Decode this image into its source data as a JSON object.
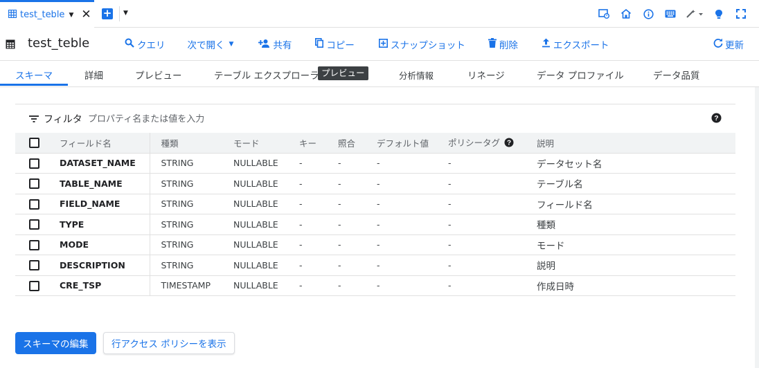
{
  "colors": {
    "accent": "#1a73e8",
    "text": "#202124",
    "muted": "#5f6368",
    "divider": "#e0e0e0"
  },
  "tab": {
    "name": "test_teble",
    "icon": "table-icon"
  },
  "header": {
    "title": "test_teble",
    "actions": [
      {
        "id": "query",
        "label": "クエリ",
        "icon": "search-icon"
      },
      {
        "id": "open-with",
        "label": "次で開く",
        "icon": "chevron-down-icon"
      },
      {
        "id": "share",
        "label": "共有",
        "icon": "person-add-icon"
      },
      {
        "id": "copy",
        "label": "コピー",
        "icon": "copy-icon"
      },
      {
        "id": "snapshot",
        "label": "スナップショット",
        "icon": "snapshot-icon"
      },
      {
        "id": "delete",
        "label": "削除",
        "icon": "trash-icon"
      },
      {
        "id": "export",
        "label": "エクスポート",
        "icon": "upload-icon"
      }
    ],
    "refresh_label": "更新"
  },
  "subtabs": [
    {
      "label": "スキーマ",
      "active": true
    },
    {
      "label": "詳細"
    },
    {
      "label": "プレビュー"
    },
    {
      "label": "テーブル エクスプローラ"
    },
    {
      "label": "分析情報"
    },
    {
      "label": "リネージ"
    },
    {
      "label": "データ プロファイル"
    },
    {
      "label": "データ品質"
    }
  ],
  "preview_badge": "プレビュー",
  "filter": {
    "label": "フィルタ",
    "placeholder": "プロパティ名または値を入力"
  },
  "table": {
    "headers": [
      "フィールド名",
      "種類",
      "モード",
      "キー",
      "照合",
      "デフォルト値",
      "ポリシータグ",
      "説明"
    ],
    "rows": [
      {
        "name": "DATASET_NAME",
        "type": "STRING",
        "mode": "NULLABLE",
        "key": "-",
        "collation": "-",
        "default": "-",
        "policy": "-",
        "description": "データセット名"
      },
      {
        "name": "TABLE_NAME",
        "type": "STRING",
        "mode": "NULLABLE",
        "key": "-",
        "collation": "-",
        "default": "-",
        "policy": "-",
        "description": "テーブル名"
      },
      {
        "name": "FIELD_NAME",
        "type": "STRING",
        "mode": "NULLABLE",
        "key": "-",
        "collation": "-",
        "default": "-",
        "policy": "-",
        "description": "フィールド名"
      },
      {
        "name": "TYPE",
        "type": "STRING",
        "mode": "NULLABLE",
        "key": "-",
        "collation": "-",
        "default": "-",
        "policy": "-",
        "description": "種類"
      },
      {
        "name": "MODE",
        "type": "STRING",
        "mode": "NULLABLE",
        "key": "-",
        "collation": "-",
        "default": "-",
        "policy": "-",
        "description": "モード"
      },
      {
        "name": "DESCRIPTION",
        "type": "STRING",
        "mode": "NULLABLE",
        "key": "-",
        "collation": "-",
        "default": "-",
        "policy": "-",
        "description": "説明"
      },
      {
        "name": "CRE_TSP",
        "type": "TIMESTAMP",
        "mode": "NULLABLE",
        "key": "-",
        "collation": "-",
        "default": "-",
        "policy": "-",
        "description": "作成日時"
      }
    ]
  },
  "buttons": {
    "edit_schema": "スキーマの編集",
    "row_access": "行アクセス ポリシーを表示"
  }
}
